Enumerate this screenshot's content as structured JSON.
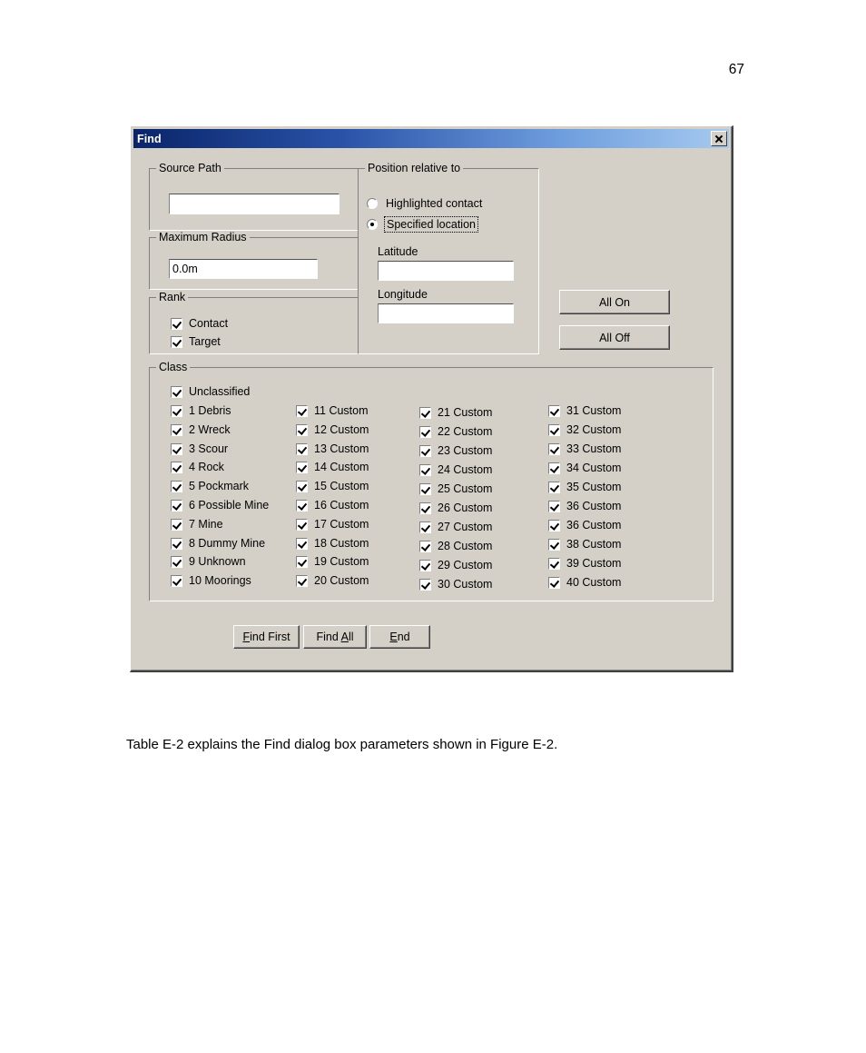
{
  "page": {
    "number": "67",
    "caption": "Table E-2 explains the Find dialog box parameters shown in Figure E-2."
  },
  "dialog": {
    "title": "Find",
    "close_label": "×",
    "source_path": {
      "group_label": "Source Path",
      "value": "",
      "placeholder": ""
    },
    "maximum_radius": {
      "group_label": "Maximum Radius",
      "value": "0.0m",
      "placeholder": ""
    },
    "rank": {
      "group_label": "Rank",
      "items": [
        {
          "label": "Contact",
          "checked": true
        },
        {
          "label": "Target",
          "checked": true
        }
      ]
    },
    "position": {
      "group_label": "Position relative to",
      "options": [
        {
          "label": "Highlighted contact",
          "selected": false,
          "focused": false
        },
        {
          "label": "Specified location",
          "selected": true,
          "focused": true
        }
      ],
      "latitude_label": "Latitude",
      "latitude_value": "",
      "longitude_label": "Longitude",
      "longitude_value": ""
    },
    "toggle_buttons": [
      {
        "label": "All On"
      },
      {
        "label": "All Off"
      }
    ],
    "class": {
      "group_label": "Class",
      "columns": [
        [
          {
            "label": "Unclassified",
            "checked": true
          },
          {
            "label": "1 Debris",
            "checked": true
          },
          {
            "label": "2 Wreck",
            "checked": true
          },
          {
            "label": "3 Scour",
            "checked": true
          },
          {
            "label": "4 Rock",
            "checked": true
          },
          {
            "label": "5 Pockmark",
            "checked": true
          },
          {
            "label": "6 Possible Mine",
            "checked": true
          },
          {
            "label": "7 Mine",
            "checked": true
          },
          {
            "label": "8 Dummy Mine",
            "checked": true
          },
          {
            "label": "9 Unknown",
            "checked": true
          },
          {
            "label": "10 Moorings",
            "checked": true
          }
        ],
        [
          {
            "label": "11 Custom",
            "checked": true
          },
          {
            "label": "12 Custom",
            "checked": true
          },
          {
            "label": "13 Custom",
            "checked": true
          },
          {
            "label": "14 Custom",
            "checked": true
          },
          {
            "label": "15 Custom",
            "checked": true
          },
          {
            "label": "16 Custom",
            "checked": true
          },
          {
            "label": "17 Custom",
            "checked": true
          },
          {
            "label": "18 Custom",
            "checked": true
          },
          {
            "label": "19 Custom",
            "checked": true
          },
          {
            "label": "20 Custom",
            "checked": true
          }
        ],
        [
          {
            "label": "21 Custom",
            "checked": true
          },
          {
            "label": "22 Custom",
            "checked": true
          },
          {
            "label": "23 Custom",
            "checked": true
          },
          {
            "label": "24 Custom",
            "checked": true
          },
          {
            "label": "25 Custom",
            "checked": true
          },
          {
            "label": "26 Custom",
            "checked": true
          },
          {
            "label": "27 Custom",
            "checked": true
          },
          {
            "label": "28 Custom",
            "checked": true
          },
          {
            "label": "29 Custom",
            "checked": true
          },
          {
            "label": "30 Custom",
            "checked": true
          }
        ],
        [
          {
            "label": "31 Custom",
            "checked": true
          },
          {
            "label": "32 Custom",
            "checked": true
          },
          {
            "label": "33 Custom",
            "checked": true
          },
          {
            "label": "34 Custom",
            "checked": true
          },
          {
            "label": "35 Custom",
            "checked": true
          },
          {
            "label": "36 Custom",
            "checked": true
          },
          {
            "label": "36 Custom",
            "checked": true
          },
          {
            "label": "38 Custom",
            "checked": true
          },
          {
            "label": "39 Custom",
            "checked": true
          },
          {
            "label": "40 Custom",
            "checked": true
          }
        ]
      ]
    },
    "action_buttons": [
      {
        "label_pre": "",
        "accel": "F",
        "label_post": "ind First"
      },
      {
        "label_pre": "Find ",
        "accel": "A",
        "label_post": "ll"
      },
      {
        "label_pre": "",
        "accel": "E",
        "label_post": "nd"
      }
    ]
  },
  "colors": {
    "dialog_face": "#d4d0c8",
    "title_gradient_start": "#0a246a",
    "title_gradient_end": "#a6caf0",
    "field_background": "#ffffff",
    "text": "#000000"
  }
}
